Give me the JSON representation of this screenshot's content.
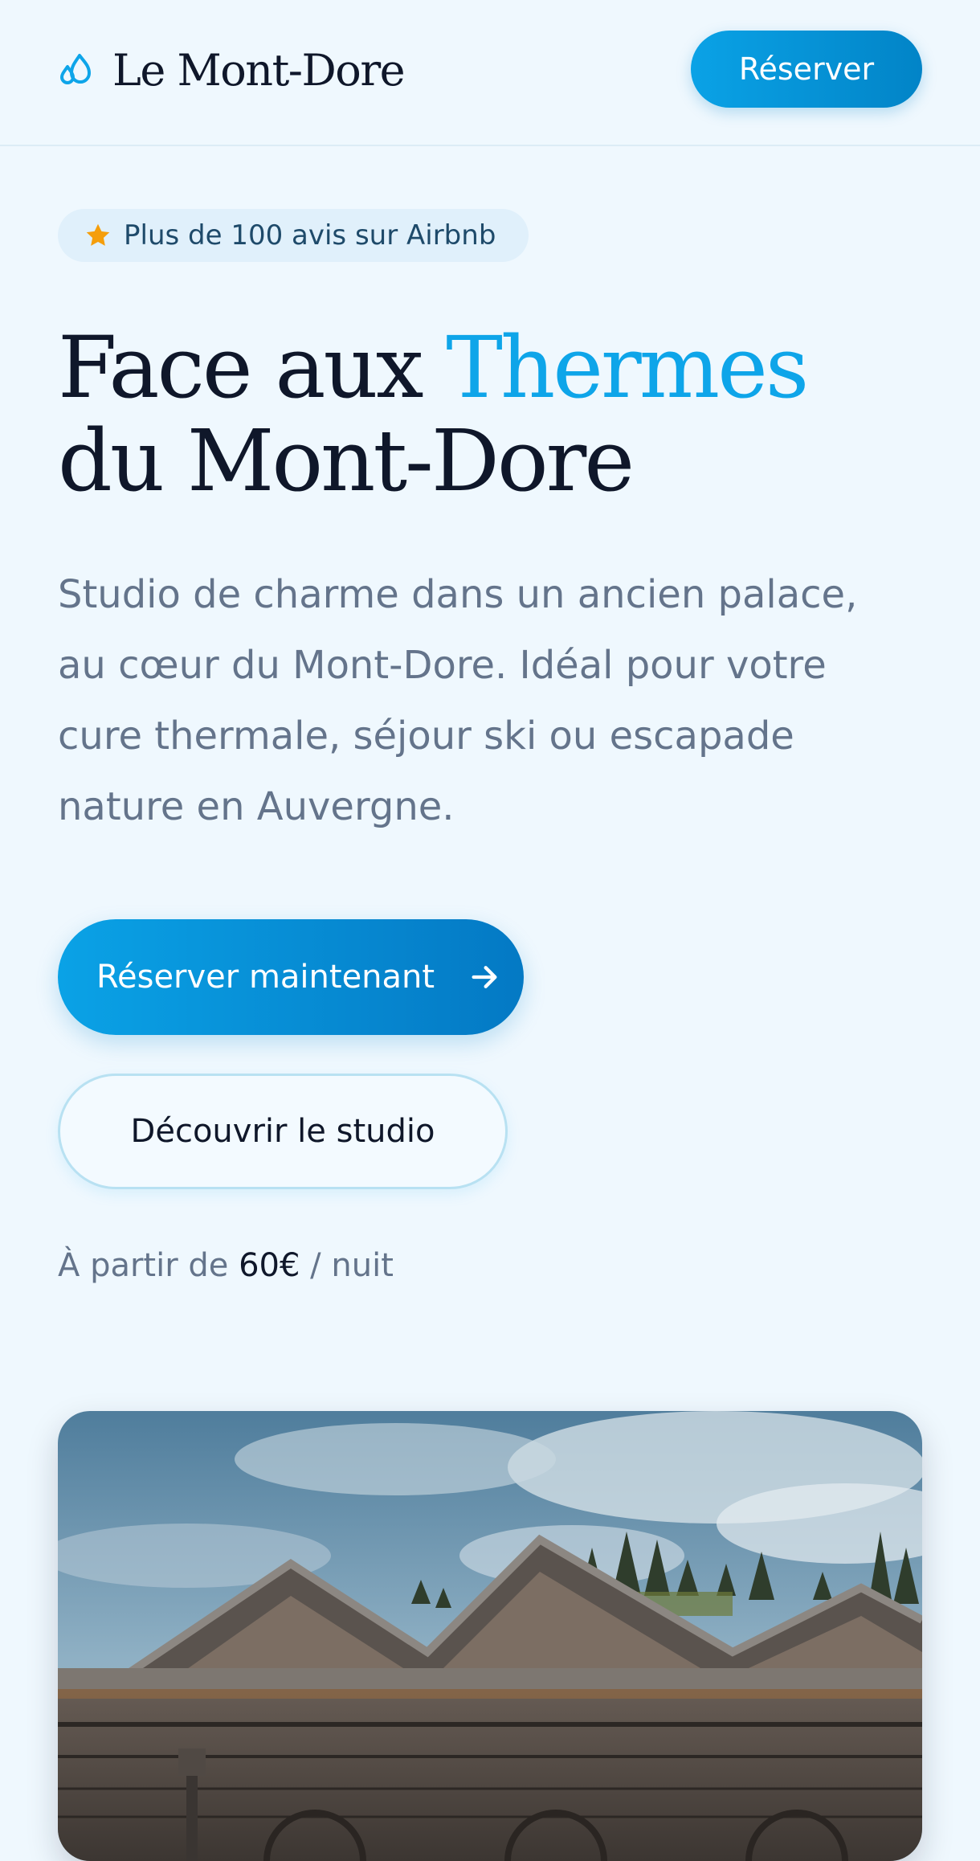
{
  "header": {
    "logo_text": "Le Mont-Dore",
    "logo_icon": "droplets-icon",
    "cta_label": "Réserver"
  },
  "badge": {
    "icon": "star-icon",
    "text": "Plus de 100 avis sur Airbnb"
  },
  "hero": {
    "title_part1": "Face aux ",
    "title_accent": "Thermes",
    "title_line2": "du Mont-Dore",
    "description": "Studio de charme dans un ancien palace, au cœur du Mont-Dore. Idéal pour votre cure thermale, séjour ski ou escapade nature en Auvergne.",
    "primary_button": "Réserver maintenant",
    "primary_button_icon": "arrow-right-icon",
    "secondary_button": "Découvrir le studio",
    "price_prefix": "À partir de ",
    "price_value": "60€",
    "price_suffix": " / nuit"
  },
  "colors": {
    "background": "#eff8fe",
    "accent": "#0ea5e9",
    "primary_button": "#0284c7",
    "text_dark": "#0f172a",
    "text_muted": "#64748b"
  },
  "image": {
    "subject": "thermes-building-photo"
  }
}
